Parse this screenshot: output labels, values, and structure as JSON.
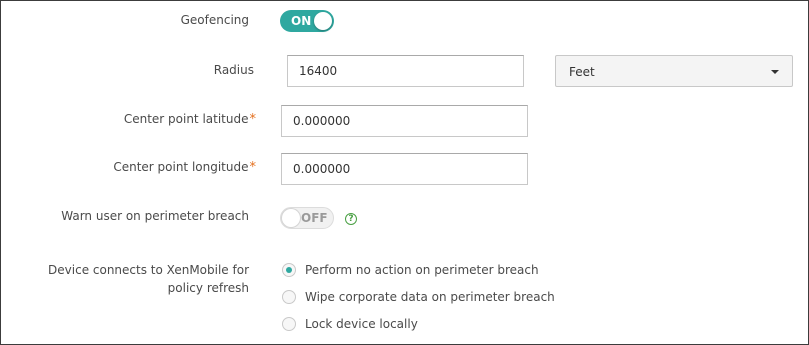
{
  "geofencing": {
    "label": "Geofencing",
    "toggle_text": "ON"
  },
  "radius": {
    "label": "Radius",
    "value": "16400",
    "unit": "Feet"
  },
  "center_latitude": {
    "label": "Center point latitude",
    "required_mark": "*",
    "value": "0.000000"
  },
  "center_longitude": {
    "label": "Center point longitude",
    "required_mark": "*",
    "value": "0.000000"
  },
  "warn_user": {
    "label": "Warn user on perimeter breach",
    "toggle_text": "OFF",
    "help_glyph": "?"
  },
  "device_connects": {
    "label": "Device connects to XenMobile for policy refresh",
    "options": [
      {
        "label": "Perform no action on perimeter breach",
        "checked": true
      },
      {
        "label": "Wipe corporate data on perimeter breach",
        "checked": false
      },
      {
        "label": "Lock device locally",
        "checked": false
      }
    ]
  },
  "colors": {
    "accent": "#2fa8a0",
    "required": "#e36f1e",
    "help": "#4aa044",
    "border": "#3c3c3c"
  },
  "icons": {
    "dropdown": "caret-down-icon",
    "help": "help-circle-icon"
  }
}
